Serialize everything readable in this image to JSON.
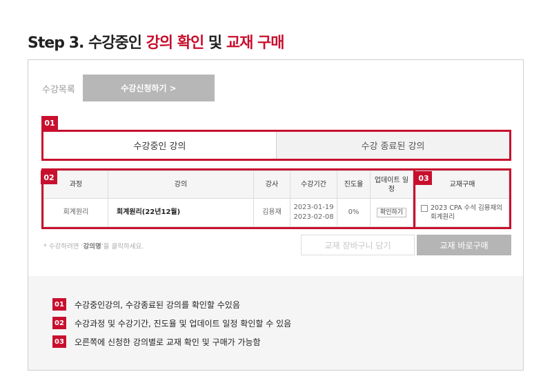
{
  "title": {
    "prefix": "Step 3. 수강중인 ",
    "accent1": "강의 확인",
    "middle": " 및 ",
    "accent2": "교재 구매"
  },
  "top": {
    "list_label": "수강목록",
    "apply_button": "수강신청하기 >"
  },
  "markers": [
    "01",
    "02",
    "03"
  ],
  "tabs": [
    {
      "label": "수강중인 강의",
      "active": true
    },
    {
      "label": "수강 종료된 강의",
      "active": false
    }
  ],
  "course_table": {
    "headers": [
      "과정",
      "강의",
      "강사",
      "수강기간",
      "진도율",
      "업데이트 일정"
    ],
    "row": {
      "course": "회계원리",
      "lecture": "회계원리(22년12월)",
      "instructor": "김용재",
      "period_start": "2023-01-19",
      "period_end": "2023-02-08",
      "progress": "0%",
      "update_button": "확인하기"
    }
  },
  "books_table": {
    "header": "교재구매",
    "item": "2023 CPA 수석 김용재의 회계원리"
  },
  "notice": {
    "pre": "* 수강하려면 ‘",
    "bold": "강의명",
    "post": "’을 클릭하세요."
  },
  "buttons": {
    "cart": "교재 장바구니 담기",
    "buy": "교재 바로구매"
  },
  "info": [
    {
      "num": "01",
      "text": "수강중인강의, 수강종료된 강의를 확인할 수있음"
    },
    {
      "num": "02",
      "text": "수강과정 및 수강기간, 진도율 및 업데이트 일정 확인할 수 있음"
    },
    {
      "num": "03",
      "text": "오른쪽에 신청한 강의별로 교재 확인 및 구매가 가능함"
    }
  ],
  "colors": {
    "accent": "#c8102e",
    "button_gray": "#b5b5b5",
    "panel_bg": "#f5f5f5"
  }
}
